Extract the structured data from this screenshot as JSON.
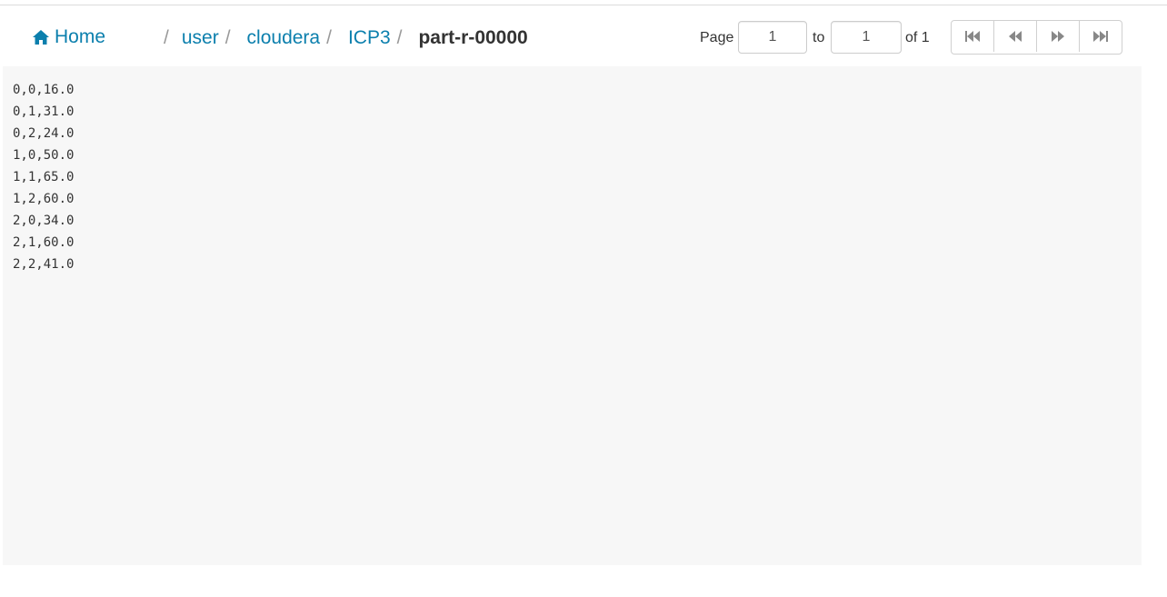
{
  "header": {
    "home_label": "Home",
    "breadcrumb": {
      "separator": "/",
      "items": [
        "user",
        "cloudera",
        "ICP3"
      ],
      "current": "part-r-00000"
    }
  },
  "pager": {
    "page_label": "Page",
    "from_value": "1",
    "to_label": "to",
    "to_value": "1",
    "of_label": "of 1",
    "buttons": [
      "first-page-icon",
      "previous-page-icon",
      "next-page-icon",
      "last-page-icon"
    ]
  },
  "file_content": {
    "lines": [
      "0,0,16.0",
      "0,1,31.0",
      "0,2,24.0",
      "1,0,50.0",
      "1,1,65.0",
      "1,2,60.0",
      "2,0,34.0",
      "2,1,60.0",
      "2,2,41.0"
    ]
  },
  "colors": {
    "link": "#0B7FAD",
    "content_bg": "#f7f7f7",
    "icon_gray": "#888888"
  }
}
